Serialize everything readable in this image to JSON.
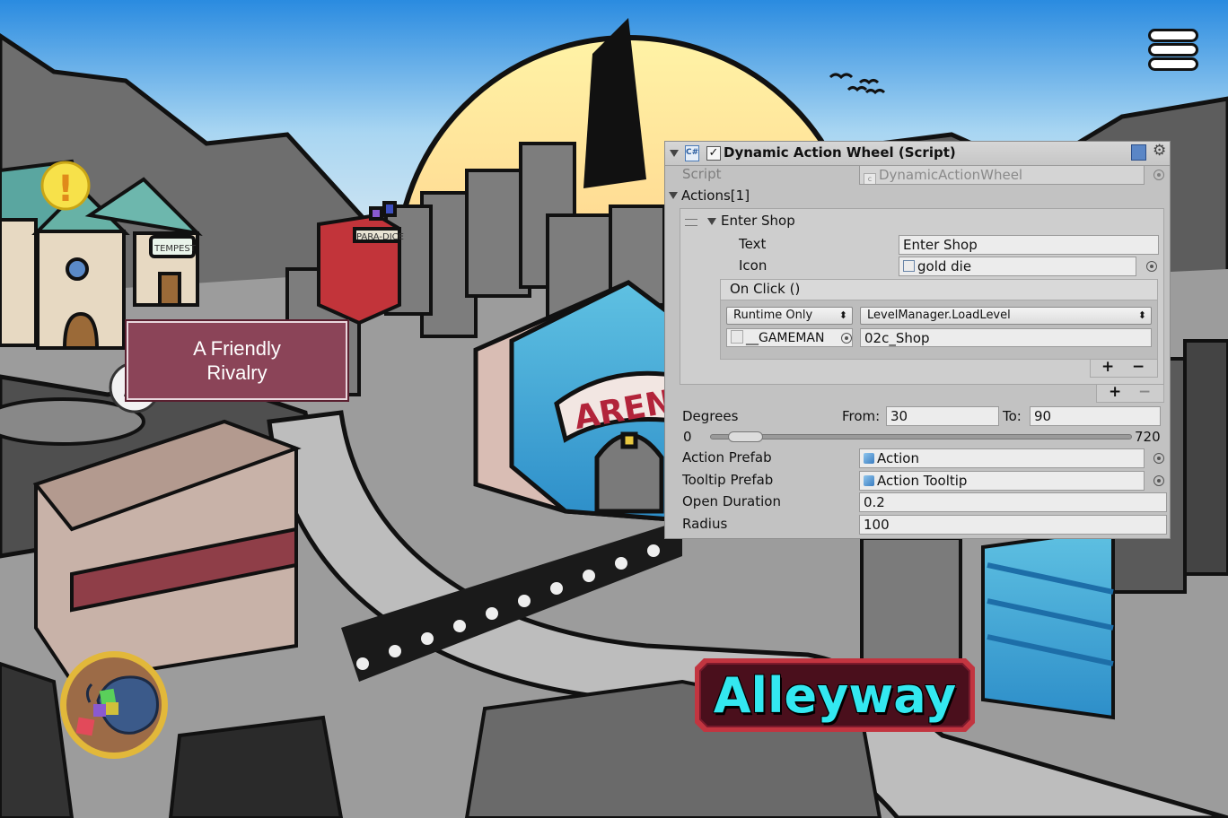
{
  "game": {
    "tooltip_line1": "A Friendly",
    "tooltip_line2": "Rivalry",
    "location_title": "Alleyway",
    "menu_icon": "hamburger-menu-icon",
    "inventory_icon": "dice-bag-icon",
    "quest_icon": "exclamation-icon",
    "sign_tempest": "TEMPEST",
    "sign_paradise": "PARA-DICE",
    "sign_arena": "ARENA"
  },
  "inspector": {
    "header_title": "Dynamic Action Wheel (Script)",
    "enabled": true,
    "script_label": "Script",
    "script_value": "DynamicActionWheel",
    "actions_label": "Actions[1]",
    "element_label": "Enter Shop",
    "text_label": "Text",
    "text_value": "Enter Shop",
    "icon_label": "Icon",
    "icon_value": "gold die",
    "onclick_label": "On Click ()",
    "runtime_option": "Runtime Only",
    "function_option": "LevelManager.LoadLevel",
    "target_object": "__GAMEMAN",
    "argument_value": "02c_Shop",
    "plus": "+",
    "minus": "−",
    "degrees_label": "Degrees",
    "from_label": "From:",
    "from_value": "30",
    "to_label": "To:",
    "to_value": "90",
    "slider_min": "0",
    "slider_max": "720",
    "slider_range": [
      30,
      90
    ],
    "action_prefab_label": "Action Prefab",
    "action_prefab_value": "Action",
    "tooltip_prefab_label": "Tooltip Prefab",
    "tooltip_prefab_value": "Action Tooltip",
    "open_duration_label": "Open Duration",
    "open_duration_value": "0.2",
    "radius_label": "Radius",
    "radius_value": "100"
  }
}
